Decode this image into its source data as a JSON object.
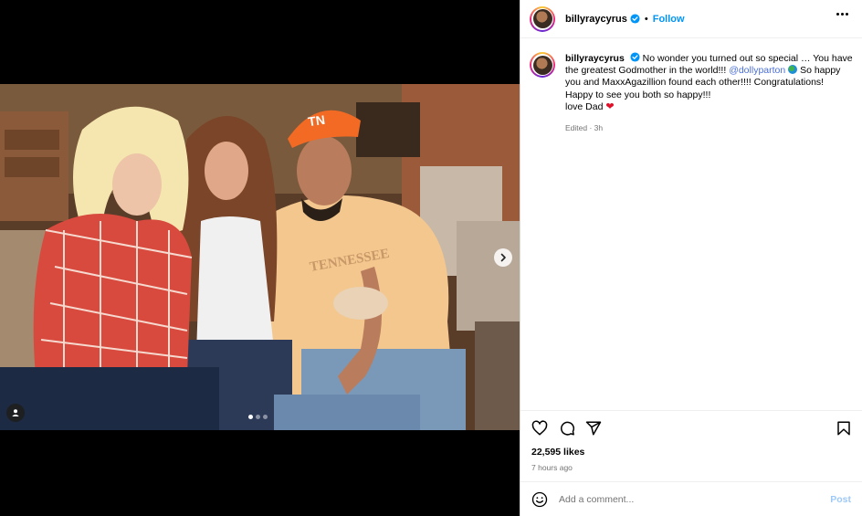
{
  "post": {
    "username": "billyraycyrus",
    "separator": "•",
    "follow_label": "Follow"
  },
  "caption": {
    "username": "billyraycyrus",
    "text_1": "No wonder you turned out so special … You have the greatest Godmother in the world!!!",
    "mention": "@dollyparton",
    "text_2": "So happy you and MaxxAgazillion found each other!!!! Congratulations! Happy to see you both so happy!!!",
    "text_3": "love Dad",
    "meta": "Edited · 3h"
  },
  "engagement": {
    "likes": "22,595 likes",
    "time": "7 hours ago"
  },
  "comment": {
    "placeholder": "Add a comment...",
    "post_label": "Post"
  },
  "carousel": {
    "slide_count": 3,
    "active_index": 0
  },
  "icons": {
    "verified": "verified-badge-icon",
    "more": "more-options-icon",
    "like": "heart-icon",
    "comment": "comment-icon",
    "share": "share-icon",
    "save": "bookmark-icon",
    "emoji": "emoji-icon",
    "next": "chevron-right-icon",
    "tags": "user-tag-icon"
  },
  "colors": {
    "follow": "#0095f6",
    "verified": "#0095f6",
    "mention": "#4b6fd8",
    "heart": "#e0102a",
    "post_disabled": "#9ec9f7"
  }
}
